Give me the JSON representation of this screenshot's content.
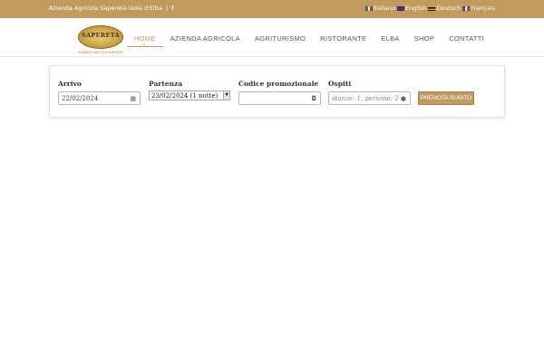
{
  "topbar": {
    "site_name": "Azienda Agricola Sapereta Isola d'Elba",
    "separator": "|",
    "facebook_icon": "f",
    "languages": [
      {
        "label": "Italiano",
        "flag": "flag-it-icon"
      },
      {
        "label": "English",
        "flag": "flag-en-icon"
      },
      {
        "label": "Deutsch",
        "flag": "flag-de-icon"
      },
      {
        "label": "Français",
        "flag": "flag-fr-icon"
      }
    ]
  },
  "logo": {
    "name": "SAPERETA",
    "subtitle": "AZIENDA AGRICOLA SAPERETA"
  },
  "nav": {
    "items": [
      {
        "label": "HOME",
        "active": true
      },
      {
        "label": "AZIENDA AGRICOLA",
        "active": false
      },
      {
        "label": "AGRITURISMO",
        "active": false
      },
      {
        "label": "RISTORANTE",
        "active": false
      },
      {
        "label": "ELBA",
        "active": false
      },
      {
        "label": "SHOP",
        "active": false
      },
      {
        "label": "CONTATTI",
        "active": false
      }
    ]
  },
  "booking": {
    "arrival_label": "Arrivo",
    "arrival_value": "22/02/2024",
    "departure_label": "Partenza",
    "departure_value": "23/02/2024 (1 notte)",
    "promo_label": "Codice promozionale",
    "promo_value": "",
    "guests_label": "Ospiti",
    "guests_placeholder": "stanze: 1, persone: 2",
    "submit_label": "PRENOTA SUBITO"
  },
  "colors": {
    "brand": "#c09a5e",
    "text": "#333333"
  }
}
